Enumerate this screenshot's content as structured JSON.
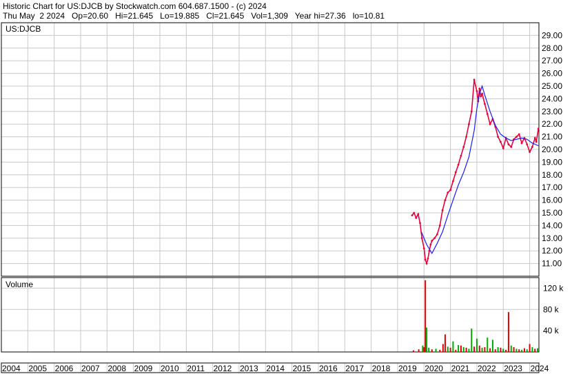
{
  "header": {
    "line1": "Historic Chart for US:DJCB by Stockwatch.com 604.687.1500 - (c) 2024",
    "line2": "Thu May  2 2024   Op=20.60   Hi=21.645   Lo=19.885   Cl=21.645   Vol=1,309   Year hi=27.36   lo=10.81"
  },
  "chart_data": [
    {
      "type": "line",
      "panel": "price",
      "title": "US:DJCB",
      "y_tick_labels": [
        "11.00",
        "12.00",
        "13.00",
        "14.00",
        "15.00",
        "16.00",
        "17.00",
        "18.00",
        "19.00",
        "20.00",
        "21.00",
        "22.00",
        "23.00",
        "24.00",
        "25.00",
        "26.00",
        "27.00",
        "28.00",
        "29.00"
      ],
      "ylim": [
        10.0,
        30.0
      ],
      "x_tick_labels": [
        "2004",
        "2005",
        "2006",
        "2007",
        "2008",
        "2009",
        "2010",
        "2011",
        "2012",
        "2013",
        "2014",
        "2015",
        "2016",
        "2017",
        "2018",
        "2019",
        "2020",
        "2021",
        "2022",
        "2023",
        "2024"
      ],
      "xlim": [
        2004.0,
        2024.35
      ],
      "grid": true,
      "series": [
        {
          "name": "",
          "color": "#e8003c",
          "x": [
            2019.55,
            2019.62,
            2019.7,
            2019.78,
            2019.85,
            2019.92,
            2020.0,
            2020.05,
            2020.1,
            2020.15,
            2020.2,
            2020.25,
            2020.3,
            2020.4,
            2020.5,
            2020.6,
            2020.7,
            2020.8,
            2020.9,
            2021.0,
            2021.1,
            2021.2,
            2021.3,
            2021.4,
            2021.5,
            2021.6,
            2021.7,
            2021.8,
            2021.9,
            2022.0,
            2022.05,
            2022.1,
            2022.15,
            2022.2,
            2022.3,
            2022.4,
            2022.5,
            2022.6,
            2022.7,
            2022.8,
            2022.9,
            2023.0,
            2023.1,
            2023.2,
            2023.3,
            2023.4,
            2023.5,
            2023.6,
            2023.7,
            2023.8,
            2023.9,
            2024.0,
            2024.1,
            2024.2,
            2024.25,
            2024.33
          ],
          "values": [
            14.8,
            15.0,
            14.6,
            14.9,
            14.2,
            13.0,
            12.2,
            11.3,
            11.0,
            11.4,
            12.0,
            12.5,
            12.8,
            13.0,
            13.3,
            14.0,
            15.2,
            16.0,
            16.6,
            16.8,
            17.5,
            18.2,
            18.8,
            19.5,
            20.2,
            21.0,
            22.0,
            23.0,
            25.5,
            24.6,
            23.8,
            24.8,
            24.2,
            24.4,
            23.6,
            22.8,
            22.0,
            22.4,
            21.8,
            21.0,
            20.6,
            20.1,
            20.9,
            20.4,
            20.2,
            20.8,
            21.0,
            21.2,
            20.5,
            20.9,
            20.4,
            19.8,
            20.2,
            20.9,
            20.6,
            21.645
          ]
        },
        {
          "name": "",
          "color": "#1a1aff",
          "x": [
            2019.9,
            2020.1,
            2020.3,
            2020.5,
            2020.7,
            2020.9,
            2021.1,
            2021.3,
            2021.5,
            2021.7,
            2021.9,
            2022.0,
            2022.1,
            2022.2,
            2022.3,
            2022.5,
            2022.7,
            2022.9,
            2023.1,
            2023.3,
            2023.5,
            2023.7,
            2023.9,
            2024.1,
            2024.33
          ],
          "values": [
            13.5,
            12.5,
            11.8,
            12.6,
            13.5,
            14.8,
            16.0,
            17.2,
            18.2,
            19.4,
            21.5,
            23.2,
            24.4,
            25.0,
            24.3,
            23.0,
            21.9,
            21.2,
            20.9,
            20.7,
            20.8,
            20.9,
            20.8,
            20.5,
            20.3
          ]
        }
      ]
    },
    {
      "type": "bar",
      "panel": "volume",
      "title": "Volume",
      "y_tick_labels": [
        "40 k",
        "80 k",
        "120 k"
      ],
      "ylim": [
        0,
        140000
      ],
      "x": [
        2019.6,
        2019.8,
        2019.95,
        2020.0,
        2020.05,
        2020.1,
        2020.18,
        2020.3,
        2020.45,
        2020.6,
        2020.72,
        2020.8,
        2020.9,
        2021.0,
        2021.1,
        2021.2,
        2021.3,
        2021.4,
        2021.5,
        2021.6,
        2021.7,
        2021.8,
        2021.9,
        2022.0,
        2022.1,
        2022.2,
        2022.3,
        2022.4,
        2022.5,
        2022.6,
        2022.7,
        2022.8,
        2022.9,
        2023.0,
        2023.1,
        2023.2,
        2023.3,
        2023.4,
        2023.5,
        2023.6,
        2023.7,
        2023.8,
        2023.9,
        2024.0,
        2024.1,
        2024.2,
        2024.3
      ],
      "values": [
        3000,
        5000,
        12000,
        9000,
        135000,
        46000,
        8000,
        5000,
        6000,
        4000,
        15000,
        33000,
        10000,
        8000,
        20000,
        4000,
        13000,
        12000,
        9000,
        8000,
        6000,
        44000,
        10000,
        25000,
        12000,
        8000,
        9000,
        27000,
        7000,
        23000,
        5000,
        9000,
        8000,
        6000,
        4000,
        75000,
        12000,
        9000,
        6000,
        5000,
        4000,
        7000,
        5000,
        15000,
        9000,
        6000,
        7000
      ],
      "colors": [
        "#e00000",
        "#e00000",
        "#00aa00",
        "#e00000",
        "#e00000",
        "#00aa00",
        "#00aa00",
        "#e00000",
        "#00aa00",
        "#e00000",
        "#e00000",
        "#e00000",
        "#00aa00",
        "#e00000",
        "#00aa00",
        "#e00000",
        "#00aa00",
        "#e00000",
        "#00aa00",
        "#e00000",
        "#00aa00",
        "#00aa00",
        "#e00000",
        "#00aa00",
        "#e00000",
        "#00aa00",
        "#e00000",
        "#00aa00",
        "#e00000",
        "#00aa00",
        "#e00000",
        "#00aa00",
        "#e00000",
        "#00aa00",
        "#e00000",
        "#e00000",
        "#00aa00",
        "#e00000",
        "#00aa00",
        "#e00000",
        "#00aa00",
        "#e00000",
        "#00aa00",
        "#e00000",
        "#00aa00",
        "#e00000",
        "#00aa00"
      ]
    }
  ]
}
